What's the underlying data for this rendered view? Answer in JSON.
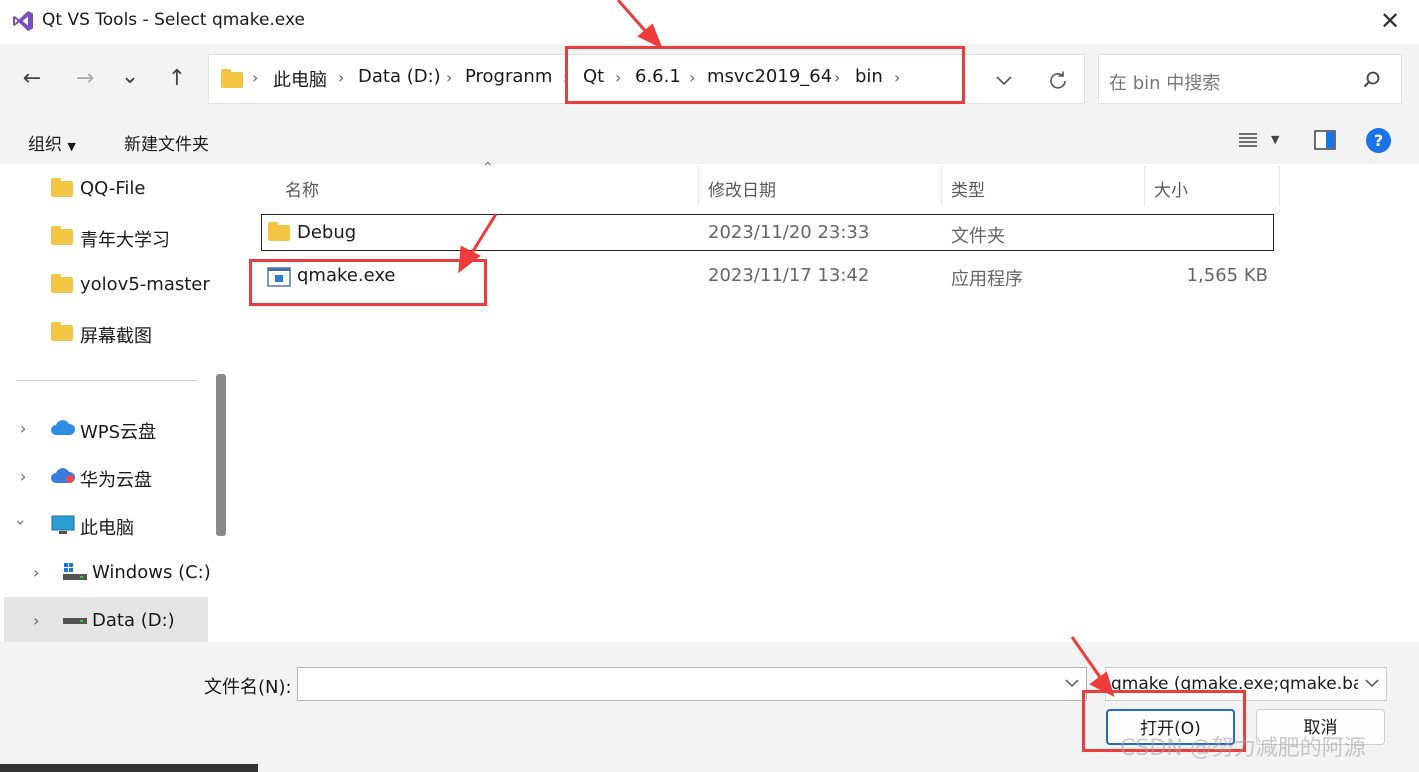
{
  "window": {
    "title": "Qt VS Tools - Select qmake.exe",
    "close_glyph": "✕"
  },
  "nav": {
    "back": "←",
    "forward": "→",
    "recent": "⌄",
    "up": "↑"
  },
  "breadcrumb": {
    "items": [
      "此电脑",
      "Data (D:)",
      "Progranm",
      "Qt",
      "6.6.1",
      "msvc2019_64",
      "bin"
    ],
    "separator": "›"
  },
  "search": {
    "placeholder": "在 bin 中搜索"
  },
  "toolbar": {
    "organize": "组织",
    "new_folder": "新建文件夹"
  },
  "sidebar": {
    "folders": [
      "QQ-File",
      "青年大学习",
      "yolov5-master",
      "屏幕截图"
    ],
    "locations": [
      {
        "label": "WPS云盘",
        "icon": "cloud-icon"
      },
      {
        "label": "华为云盘",
        "icon": "cloud-icon"
      },
      {
        "label": "此电脑",
        "icon": "computer-icon"
      },
      {
        "label": "Windows (C:)",
        "icon": "drive-icon"
      },
      {
        "label": "Data (D:)",
        "icon": "drive-icon",
        "selected": true
      }
    ]
  },
  "columns": {
    "name": "名称",
    "date": "修改日期",
    "type": "类型",
    "size": "大小"
  },
  "files": [
    {
      "name": "Debug",
      "date": "2023/11/20 23:33",
      "type": "文件夹",
      "size": "",
      "icon": "folder-icon"
    },
    {
      "name": "qmake.exe",
      "date": "2023/11/17 13:42",
      "type": "应用程序",
      "size": "1,565 KB",
      "icon": "exe-icon"
    }
  ],
  "footer": {
    "filename_label": "文件名(N):",
    "filename_value": "",
    "filter_value": "qmake (qmake.exe;qmake.bat)",
    "open_button": "打开(O)",
    "cancel_button": "取消"
  },
  "watermark": "CSDN @努力减肥的阿源",
  "colors": {
    "accent_red": "#ee3b3b",
    "folder_yellow": "#f4c542",
    "help_blue": "#1a73e8"
  }
}
